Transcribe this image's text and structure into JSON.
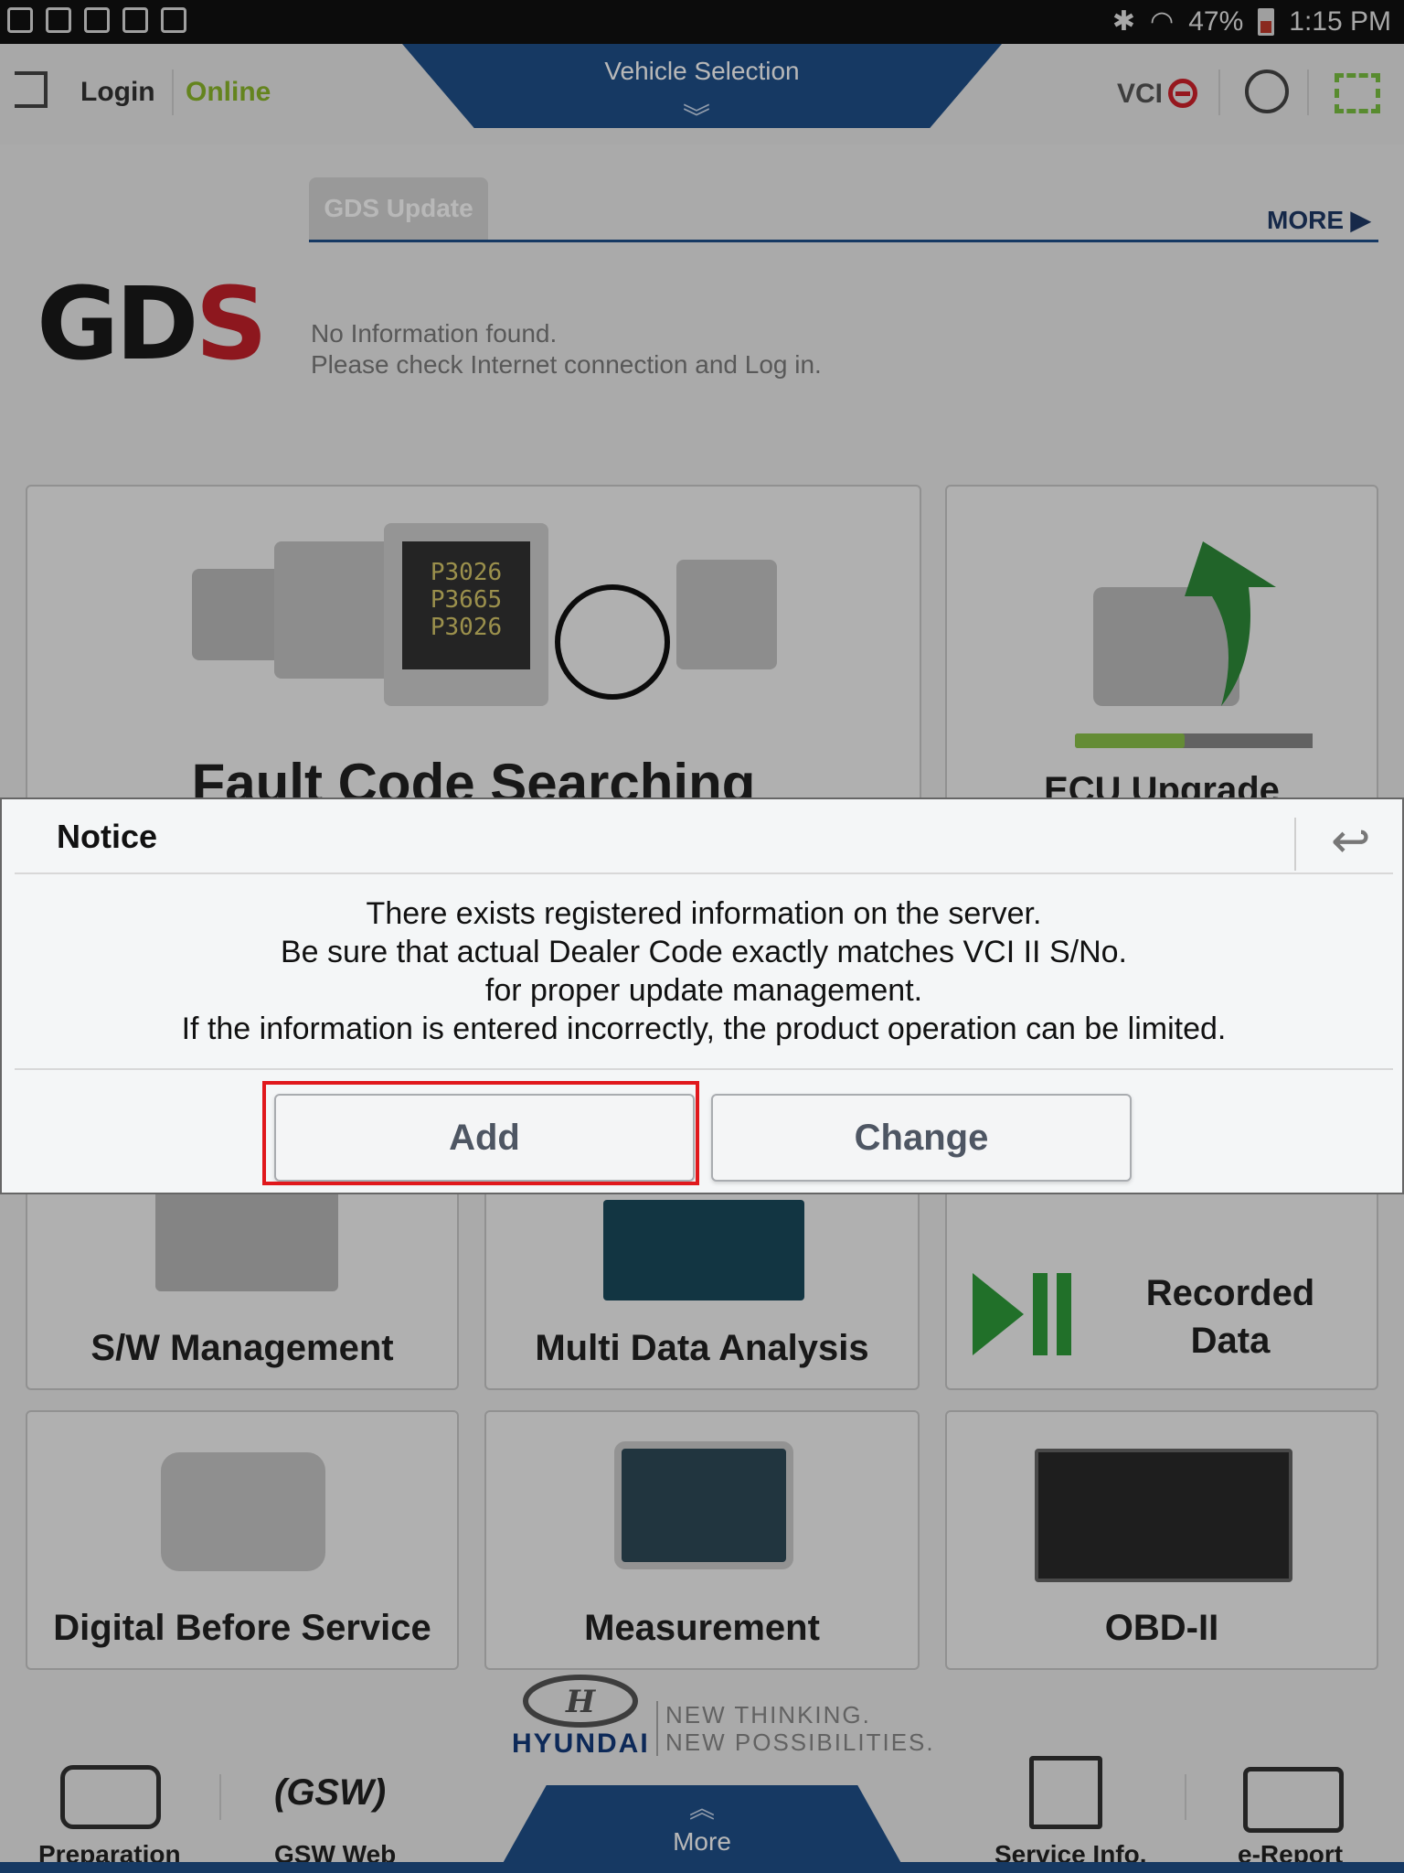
{
  "status_bar": {
    "battery": "47%",
    "time": "1:15 PM"
  },
  "topbar": {
    "login": "Login",
    "status": "Online",
    "vehicle_selection": "Vehicle Selection",
    "vci": "VCI"
  },
  "update": {
    "tab": "GDS Update",
    "more": "MORE",
    "logo_main": "GD",
    "logo_accent": "S",
    "info_line1": "No Information found.",
    "info_line2": "Please check Internet connection and Log in."
  },
  "tiles": {
    "fault_code": "Fault Code Searching",
    "fault_codes_shown": [
      "P3026",
      "P3665",
      "P3026"
    ],
    "ecu_upgrade": "ECU Upgrade",
    "sw_management": "S/W Management",
    "multi_data": "Multi Data Analysis",
    "recorded_line1": "Recorded",
    "recorded_line2": "Data",
    "digital_before": "Digital Before Service",
    "measurement": "Measurement",
    "obd": "OBD-II"
  },
  "dialog": {
    "title": "Notice",
    "lines": [
      "There exists registered information on the server.",
      "Be sure that actual Dealer Code exactly matches VCI II S/No.",
      "for proper update management.",
      "If the information is entered incorrectly, the product operation can be limited."
    ],
    "add": "Add",
    "change": "Change"
  },
  "branding": {
    "hyundai": "HYUNDAI",
    "tagline1": "NEW THINKING.",
    "tagline2": "NEW POSSIBILITIES."
  },
  "bottom_nav": {
    "preparation": "Preparation",
    "gsw_web": "GSW Web",
    "more": "More",
    "service_info": "Service Info.",
    "e_report": "e-Report"
  },
  "colors": {
    "brand_blue": "#1f4f8a",
    "online_green": "#8bb72a",
    "highlight_red": "#e0181c",
    "logo_red": "#c4202a"
  }
}
